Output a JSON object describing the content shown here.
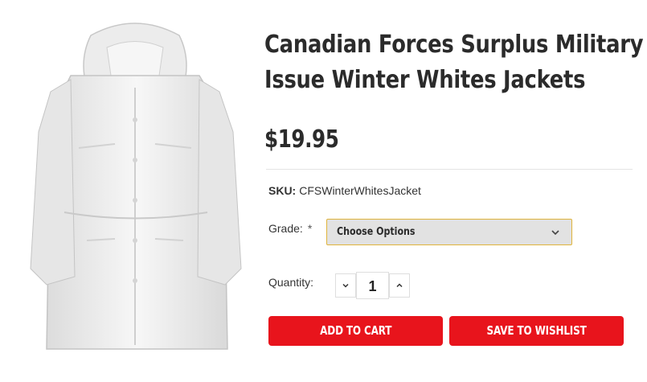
{
  "product": {
    "title_line1": "Canadian Forces Surplus Military",
    "title_line2": "Issue Winter Whites Jackets",
    "price": "$19.95",
    "image_alt": "White military winter jacket with hood"
  },
  "sku": {
    "label": "SKU:",
    "value": "CFSWinterWhitesJacket"
  },
  "grade": {
    "label": "Grade:",
    "required_mark": "*",
    "selected": "Choose Options"
  },
  "quantity": {
    "label": "Quantity:",
    "value": "1"
  },
  "actions": {
    "add_to_cart": "ADD TO CART",
    "save_to_wishlist": "SAVE TO WISHLIST"
  },
  "colors": {
    "accent_red": "#e8141c",
    "select_border": "#e0b43c",
    "text_dark": "#2b2b2b"
  },
  "icons": {
    "decrement": "chevron-down-icon",
    "increment": "chevron-up-icon",
    "dropdown": "chevron-down-icon"
  }
}
